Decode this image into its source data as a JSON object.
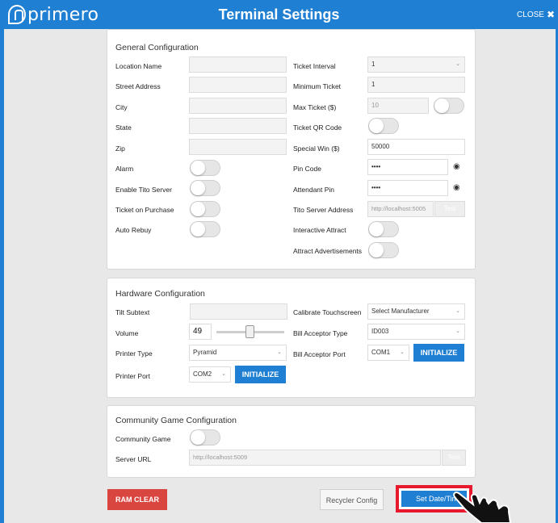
{
  "header": {
    "logo_text": "primero",
    "title": "Terminal Settings",
    "close_label": "CLOSE",
    "close_glyph": "✖"
  },
  "general": {
    "title": "General Configuration",
    "location_name": {
      "label": "Location Name",
      "value": ""
    },
    "street_address": {
      "label": "Street Address",
      "value": ""
    },
    "city": {
      "label": "City",
      "value": ""
    },
    "state": {
      "label": "State",
      "value": ""
    },
    "zip": {
      "label": "Zip",
      "value": ""
    },
    "alarm": {
      "label": "Alarm",
      "on": false
    },
    "enable_tito_server": {
      "label": "Enable Tito Server",
      "on": false
    },
    "ticket_on_purchase": {
      "label": "Ticket on Purchase",
      "on": false
    },
    "auto_rebuy": {
      "label": "Auto Rebuy",
      "on": false
    },
    "ticket_interval": {
      "label": "Ticket Interval",
      "value": "1"
    },
    "minimum_ticket": {
      "label": "Minimum Ticket",
      "value": "1"
    },
    "max_ticket": {
      "label": "Max Ticket ($)",
      "value": "10",
      "on": false
    },
    "ticket_qr_code": {
      "label": "Ticket QR Code",
      "on": false
    },
    "special_win": {
      "label": "Special Win ($)",
      "value": "50000"
    },
    "pin_code": {
      "label": "Pin Code",
      "value": "••••"
    },
    "attendant_pin": {
      "label": "Attendant Pin",
      "value": "••••"
    },
    "tito_server_address": {
      "label": "Tito Server Address",
      "value": "http://localhost:5005",
      "button": "Test"
    },
    "interactive_attract": {
      "label": "Interactive Attract",
      "on": false
    },
    "attract_advertisements": {
      "label": "Attract Advertisements",
      "on": false
    }
  },
  "hardware": {
    "title": "Hardware Configuration",
    "tilt_subtext": {
      "label": "Tilt Subtext",
      "value": ""
    },
    "volume": {
      "label": "Volume",
      "value": "49",
      "level": 0.49
    },
    "printer_type": {
      "label": "Printer Type",
      "value": "Pyramid"
    },
    "printer_port": {
      "label": "Printer Port",
      "value": "COM2",
      "button": "INITIALIZE"
    },
    "calibrate_touchscreen": {
      "label": "Calibrate Touchscreen",
      "value": "Select Manufacturer"
    },
    "bill_acceptor_type": {
      "label": "Bill Acceptor Type",
      "value": "ID003"
    },
    "bill_acceptor_port": {
      "label": "Bill Acceptor Port",
      "value": "COM1",
      "button": "INITIALIZE"
    }
  },
  "community": {
    "title": "Community Game Configuration",
    "community_game": {
      "label": "Community Game",
      "on": false
    },
    "server_url": {
      "label": "Server URL",
      "value": "http://localhost:5009",
      "button": "Test"
    }
  },
  "actions": {
    "ram_clear": "RAM CLEAR",
    "recycler_config": "Recycler Config",
    "set_date_time": "Set Date/Time"
  },
  "colors": {
    "accent": "#1f7fd3",
    "danger": "#d9453f",
    "highlight": "#e8192c"
  }
}
